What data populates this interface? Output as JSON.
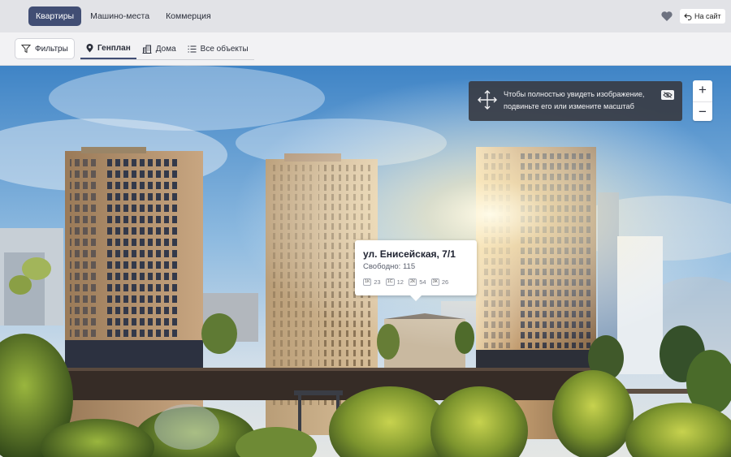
{
  "topbar": {
    "tabs": [
      {
        "label": "Квартиры",
        "active": true
      },
      {
        "label": "Машино-места",
        "active": false
      },
      {
        "label": "Коммерция",
        "active": false
      }
    ],
    "to_site_label": "На сайт"
  },
  "subbar": {
    "filters_label": "Фильтры",
    "view_tabs": [
      {
        "label": "Генплан",
        "icon": "map-pin-icon",
        "active": true
      },
      {
        "label": "Дома",
        "icon": "building-icon",
        "active": false
      },
      {
        "label": "Все объекты",
        "icon": "list-icon",
        "active": false
      }
    ]
  },
  "hint": {
    "text": "Чтобы полностью увидеть изображение, подвиньте его или измените масштаб"
  },
  "zoom": {
    "in_label": "+",
    "out_label": "−"
  },
  "popup": {
    "address": "ул. Енисейская, 7/1",
    "free_text": "Свободно: 115",
    "types": [
      {
        "tag": "1К",
        "count": "23"
      },
      {
        "tag": "1С",
        "count": "12"
      },
      {
        "tag": "2К",
        "count": "54"
      },
      {
        "tag": "3К",
        "count": "26"
      }
    ]
  },
  "colors": {
    "accent": "#414e74",
    "hint_bg": "#383c44"
  }
}
